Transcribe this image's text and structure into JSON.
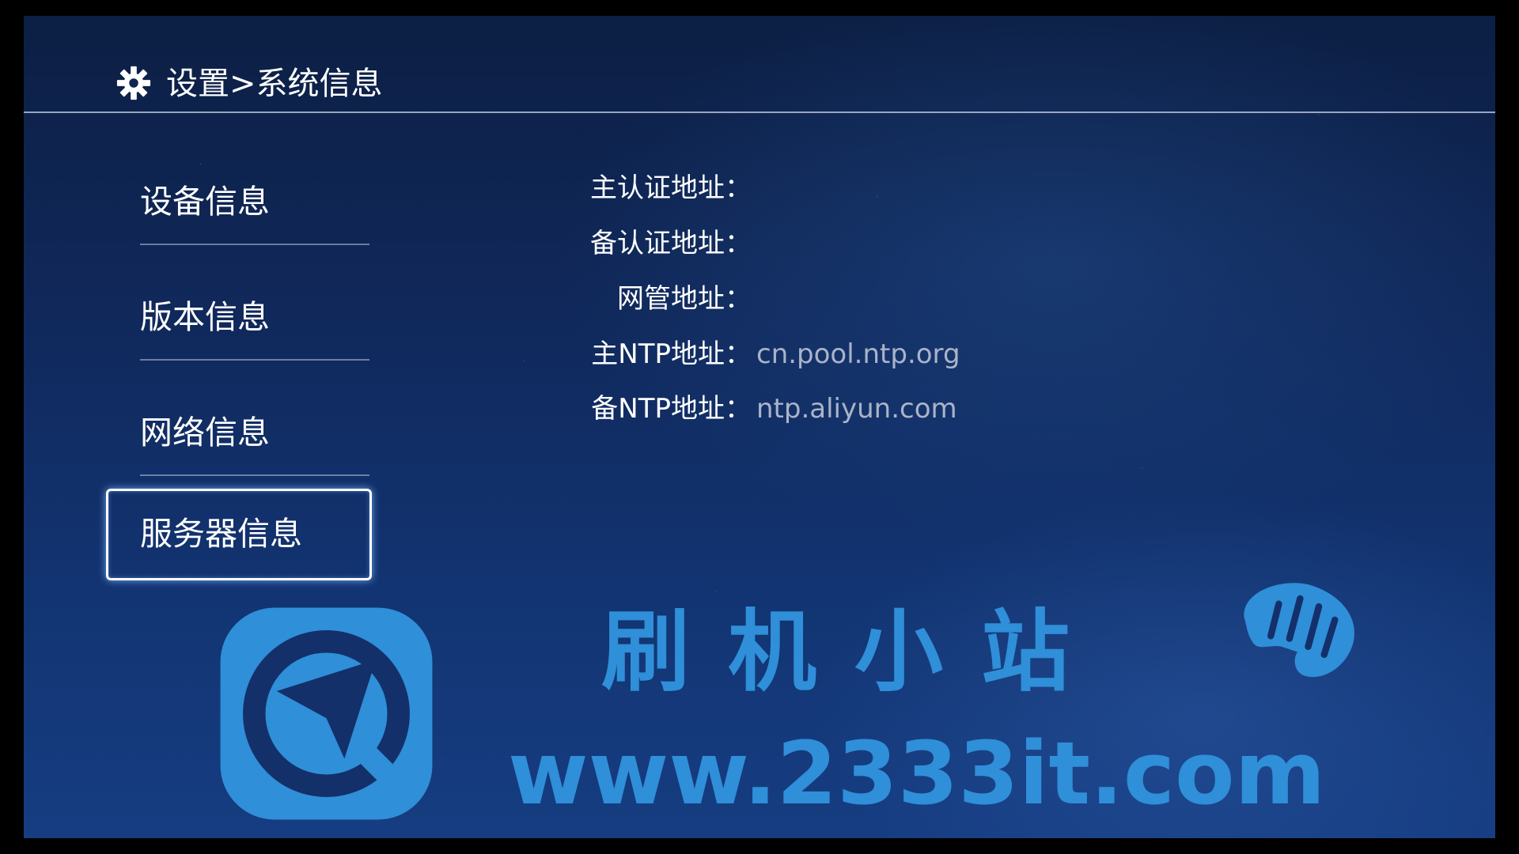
{
  "header": {
    "title": "设置>系统信息",
    "icon": "gear-icon"
  },
  "sidebar": {
    "items": [
      {
        "label": "设备信息",
        "selected": false
      },
      {
        "label": "版本信息",
        "selected": false
      },
      {
        "label": "网络信息",
        "selected": false
      },
      {
        "label": "服务器信息",
        "selected": true
      }
    ]
  },
  "server_info": {
    "rows": [
      {
        "label": "主认证地址：",
        "value": ""
      },
      {
        "label": "备认证地址：",
        "value": ""
      },
      {
        "label": "网管地址：",
        "value": ""
      },
      {
        "label": "主NTP地址：",
        "value": "cn.pool.ntp.org"
      },
      {
        "label": "备NTP地址：",
        "value": "ntp.aliyun.com"
      }
    ]
  },
  "watermark": {
    "name": "刷机小站",
    "url": "www.2333it.com",
    "color": "#2f8fd8"
  },
  "colors": {
    "background": "#10285a",
    "label_text": "#ffffff",
    "value_text": "#a9b4c8",
    "focus_border": "#ffffff"
  }
}
